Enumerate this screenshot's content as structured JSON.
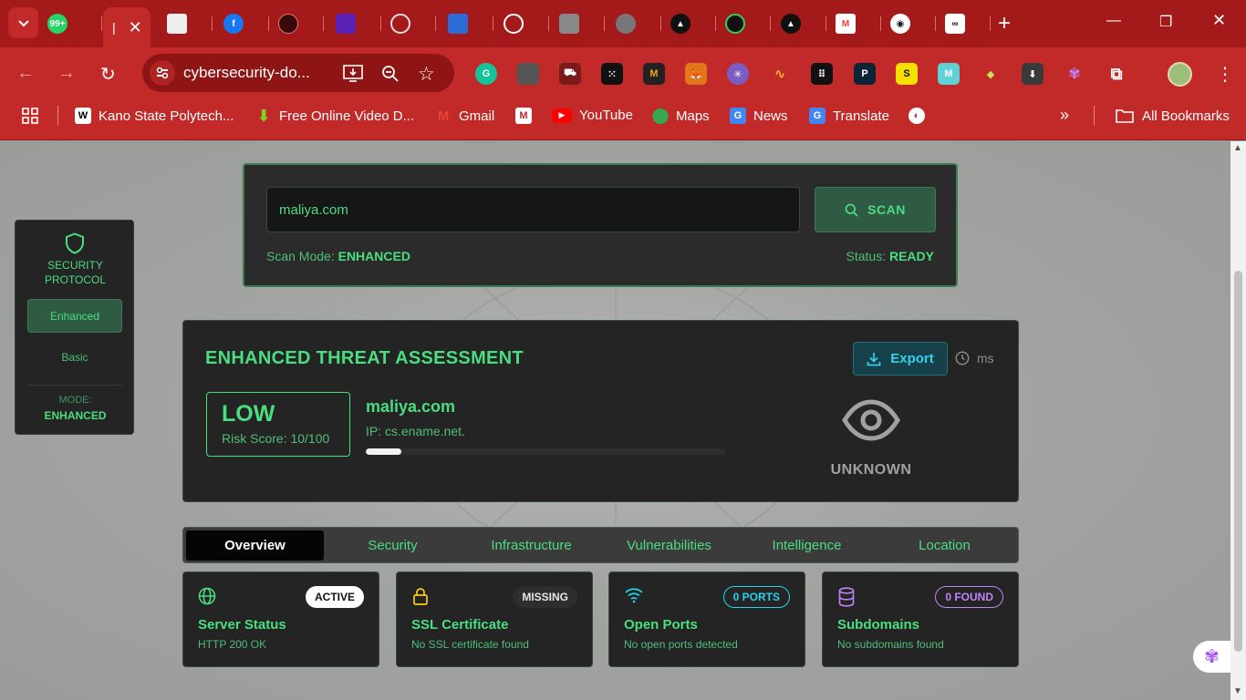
{
  "browser": {
    "active_tab_close": "✕",
    "new_tab": "+",
    "url": "cybersecurity-do...",
    "bookmarks": [
      {
        "label": "Kano State Polytech...",
        "icon": "wikipedia-icon",
        "color": "#ffffff"
      },
      {
        "label": "Free Online Video D...",
        "icon": "download-arrow-icon",
        "color": "#7ed321"
      },
      {
        "label": "Gmail",
        "icon": "gmail-icon",
        "color": "#ea4335"
      },
      {
        "label": "YouTube",
        "icon": "youtube-icon",
        "color": "#ff0000"
      },
      {
        "label": "Maps",
        "icon": "maps-icon",
        "color": "#34a853"
      },
      {
        "label": "News",
        "icon": "news-icon",
        "color": "#4285f4"
      },
      {
        "label": "Translate",
        "icon": "translate-icon",
        "color": "#4285f4"
      }
    ],
    "all_bookmarks": "All Bookmarks",
    "more_bookmarks": "»"
  },
  "scan": {
    "input_value": "maliya.com",
    "button_label": "SCAN",
    "mode_label": "Scan Mode:",
    "mode_value": "ENHANCED",
    "status_label": "Status:",
    "status_value": "READY"
  },
  "side": {
    "title_line1": "SECURITY",
    "title_line2": "PROTOCOL",
    "option_active": "Enhanced",
    "option_other": "Basic",
    "mode_label": "MODE:",
    "mode_value": "ENHANCED"
  },
  "assessment": {
    "title": "ENHANCED THREAT ASSESSMENT",
    "export_label": "Export",
    "time_unit": "ms",
    "risk_level": "LOW",
    "risk_score": "Risk Score: 10/100",
    "risk_progress": 0.1,
    "domain": "maliya.com",
    "ip": "IP: cs.ename.net.",
    "visibility": "UNKNOWN"
  },
  "tabs": [
    "Overview",
    "Security",
    "Infrastructure",
    "Vulnerabilities",
    "Intelligence",
    "Location"
  ],
  "cards": [
    {
      "title": "Server Status",
      "subtitle": "HTTP 200 OK",
      "badge": "ACTIVE",
      "icon": "globe-icon",
      "color": "#4ade80"
    },
    {
      "title": "SSL Certificate",
      "subtitle": "No SSL certificate found",
      "badge": "MISSING",
      "icon": "lock-icon",
      "color": "#facc15"
    },
    {
      "title": "Open Ports",
      "subtitle": "No open ports detected",
      "badge": "0 PORTS",
      "icon": "wifi-icon",
      "color": "#22d3ee"
    },
    {
      "title": "Subdomains",
      "subtitle": "No subdomains found",
      "badge": "0 FOUND",
      "icon": "database-icon",
      "color": "#c084fc"
    }
  ]
}
